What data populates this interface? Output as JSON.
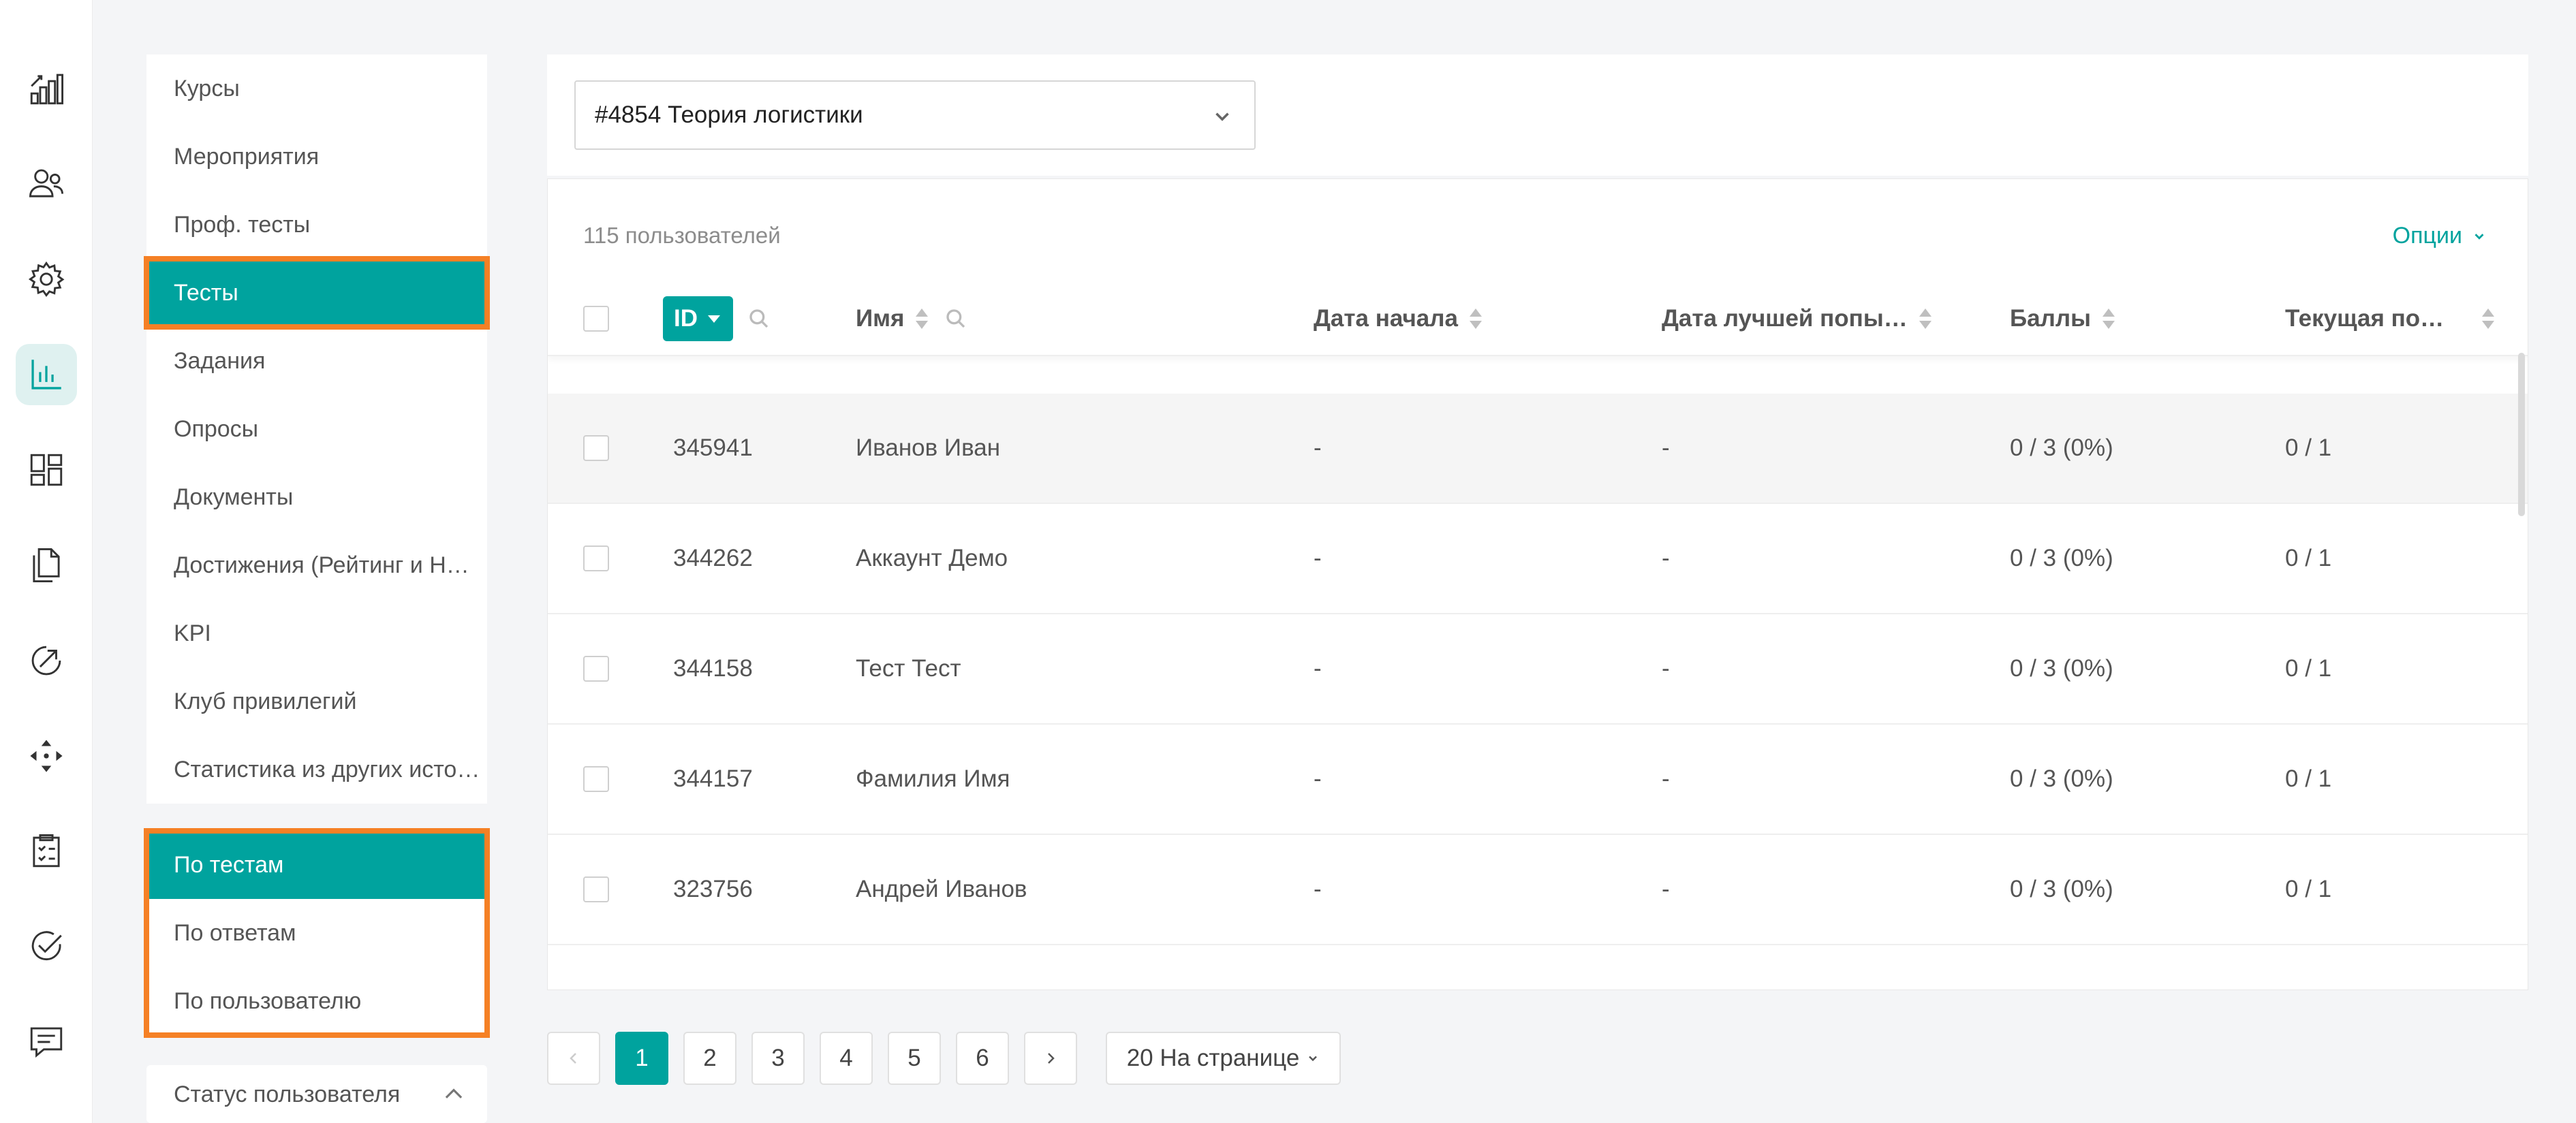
{
  "rail": {
    "icons": [
      "chart-growth-icon",
      "users-icon",
      "gear-icon",
      "bar-chart-icon",
      "dashboard-icon",
      "documents-icon",
      "compass-icon",
      "move-icon",
      "clipboard-icon",
      "check-circle-icon",
      "chat-icon"
    ],
    "active": "bar-chart-icon"
  },
  "sidebar": {
    "items": [
      {
        "label": "Курсы"
      },
      {
        "label": "Мероприятия"
      },
      {
        "label": "Проф. тесты"
      },
      {
        "label": "Тесты"
      },
      {
        "label": "Задания"
      },
      {
        "label": "Опросы"
      },
      {
        "label": "Документы"
      },
      {
        "label": "Достижения (Рейтинг и Н…"
      },
      {
        "label": "KPI"
      },
      {
        "label": "Клуб привилегий"
      },
      {
        "label": "Статистика из других исто…"
      }
    ],
    "selected": "Тесты"
  },
  "report_type": {
    "items": [
      {
        "label": "По тестам"
      },
      {
        "label": "По ответам"
      },
      {
        "label": "По пользователю"
      }
    ],
    "selected": "По тестам"
  },
  "user_status": {
    "label": "Статус пользователя"
  },
  "test_select": {
    "value": "#4854 Теория логистики"
  },
  "table": {
    "users_count": "115 пользователей",
    "options_label": "Опции",
    "columns": {
      "id": "ID",
      "name": "Имя",
      "start_date": "Дата начала",
      "best_attempt_date": "Дата лучшей попы…",
      "score": "Баллы",
      "current_attempt": "Текущая по…"
    },
    "rows": [
      {
        "id": "345941",
        "name": "Иванов Иван",
        "start_date": "-",
        "best_attempt_date": "-",
        "score": "0 / 3 (0%)",
        "current_attempt": "0 / 1"
      },
      {
        "id": "344262",
        "name": "Аккаунт Демо",
        "start_date": "-",
        "best_attempt_date": "-",
        "score": "0 / 3 (0%)",
        "current_attempt": "0 / 1"
      },
      {
        "id": "344158",
        "name": "Тест Тест",
        "start_date": "-",
        "best_attempt_date": "-",
        "score": "0 / 3 (0%)",
        "current_attempt": "0 / 1"
      },
      {
        "id": "344157",
        "name": "Фамилия Имя",
        "start_date": "-",
        "best_attempt_date": "-",
        "score": "0 / 3 (0%)",
        "current_attempt": "0 / 1"
      },
      {
        "id": "323756",
        "name": "Андрей Иванов",
        "start_date": "-",
        "best_attempt_date": "-",
        "score": "0 / 3 (0%)",
        "current_attempt": "0 / 1"
      }
    ]
  },
  "pagination": {
    "pages": [
      "1",
      "2",
      "3",
      "4",
      "5",
      "6"
    ],
    "current": "1",
    "per_page_label": "20 На странице"
  },
  "colors": {
    "accent": "#00a39e",
    "highlight": "#f58025"
  }
}
